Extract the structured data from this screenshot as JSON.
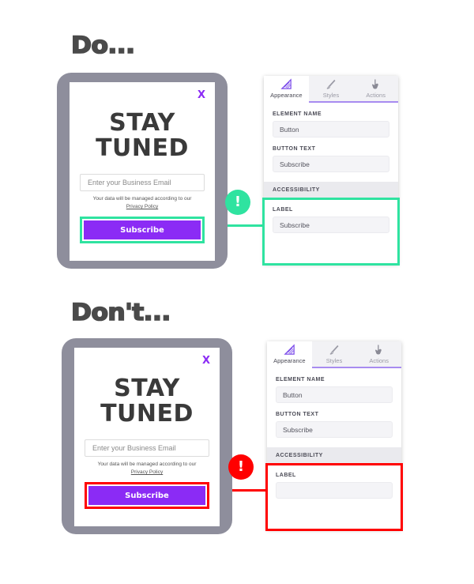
{
  "colors": {
    "purple": "#8B2BF5",
    "green": "#2FE3A0",
    "red": "#FF0000",
    "frame_gray": "#8E8E9C",
    "tab_active_text": "#4A4A55"
  },
  "sections": [
    {
      "id": "do",
      "heading": "Do...",
      "status": "good",
      "badge_glyph": "!",
      "modal": {
        "close_label": "X",
        "title_line1": "STAY",
        "title_line2": "TUNED",
        "email_placeholder": "Enter your Business Email",
        "disclaimer_text": "Your data will be managed according to our",
        "disclaimer_link": "Privacy Policy",
        "button_label": "Subscribe"
      },
      "panel": {
        "tabs": [
          {
            "label": "Appearance",
            "icon": "ruler-triangle-icon",
            "active": true
          },
          {
            "label": "Styles",
            "icon": "paintbrush-icon",
            "active": false
          },
          {
            "label": "Actions",
            "icon": "pointing-hand-icon",
            "active": false
          }
        ],
        "fields": [
          {
            "label": "ELEMENT NAME",
            "value": "Button"
          },
          {
            "label": "BUTTON TEXT",
            "value": "Subscribe"
          }
        ],
        "accessibility": {
          "section_title": "ACCESSIBILITY",
          "label": "LABEL",
          "value": "Subscribe"
        }
      }
    },
    {
      "id": "dont",
      "heading": "Don't...",
      "status": "bad",
      "badge_glyph": "!",
      "modal": {
        "close_label": "X",
        "title_line1": "STAY",
        "title_line2": "TUNED",
        "email_placeholder": "Enter your Business Email",
        "disclaimer_text": "Your data will be managed according to our",
        "disclaimer_link": "Privacy Policy",
        "button_label": "Subscribe"
      },
      "panel": {
        "tabs": [
          {
            "label": "Appearance",
            "icon": "ruler-triangle-icon",
            "active": true
          },
          {
            "label": "Styles",
            "icon": "paintbrush-icon",
            "active": false
          },
          {
            "label": "Actions",
            "icon": "pointing-hand-icon",
            "active": false
          }
        ],
        "fields": [
          {
            "label": "ELEMENT NAME",
            "value": "Button"
          },
          {
            "label": "BUTTON TEXT",
            "value": "Subscribe"
          }
        ],
        "accessibility": {
          "section_title": "ACCESSIBILITY",
          "label": "LABEL",
          "value": ""
        }
      }
    }
  ]
}
